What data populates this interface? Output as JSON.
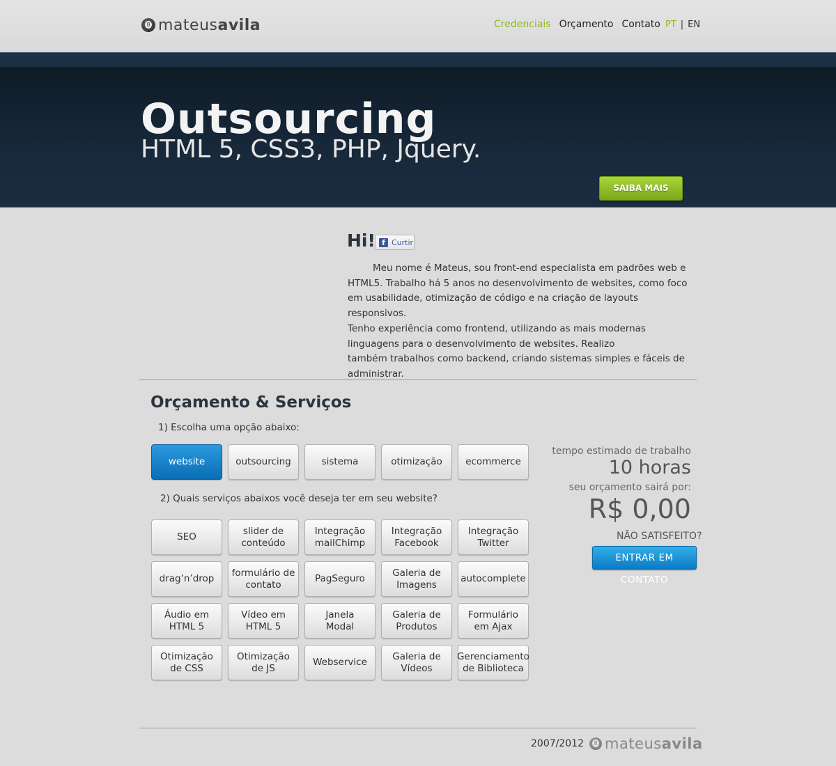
{
  "header": {
    "logo": {
      "part1": "mateus",
      "part2": "avila"
    },
    "nav": [
      "Credenciais",
      "Orçamento",
      "Contato"
    ],
    "lang": {
      "pt": "PT",
      "sep": "|",
      "en": "EN"
    }
  },
  "hero": {
    "title": "Outsourcing",
    "subtitle": "HTML 5, CSS3, PHP, Jquery.",
    "button": "SAIBA MAIS"
  },
  "intro": {
    "title": "Hi!",
    "like_label": "Curtir",
    "paragraph1": "Meu nome é Mateus, sou front-end especialista em padrões web e HTML5. Trabalho há 5 anos no desenvolvimento de websites, como foco em usabilidade, otimização de código e na criação de layouts responsivos.",
    "paragraph2": "Tenho experiência como frontend, utilizando as mais modernas linguagens para o desenvolvimento de websites. Realizo",
    "paragraph3": "também trabalhos como backend, criando sistemas simples e fáceis de administrar."
  },
  "services": {
    "title": "Orçamento & Serviços",
    "step1": "1) Escolha uma opção abaixo:",
    "options": [
      "website",
      "outsourcing",
      "sistema",
      "otimização",
      "ecommerce"
    ],
    "selected": "website",
    "step2": "2) Quais serviços abaixos você deseja ter em seu website?",
    "items": [
      "SEO",
      "slider de\nconteúdo",
      "Integração\nmailChimp",
      "Integração\nFacebook",
      "Integração\nTwitter",
      "drag’n’drop",
      "formulário de\ncontato",
      "PagSeguro",
      "Galeria de\nImagens",
      "autocomplete",
      "Áudio em\nHTML 5",
      "Vídeo em\nHTML 5",
      "Janela\nModal",
      "Galeria de\nProdutos",
      "Formulário\nem Ajax",
      "Otimização\nde CSS",
      "Otimização\nde JS",
      "Webservice",
      "Galeria de\nVídeos",
      "Gerenciamento\nde Biblioteca"
    ]
  },
  "estimate": {
    "time_label": "tempo estimado de trabalho",
    "time_value": "10 horas",
    "price_label": "seu orçamento sairá por:",
    "price_value": "R$ 0,00",
    "not_satisfied": "NÃO SATISFEITO?",
    "contact_button": "ENTRAR EM CONTATO"
  },
  "footer": {
    "years": "2007/2012",
    "logo": {
      "part1": "mateus",
      "part2": "avila"
    }
  }
}
